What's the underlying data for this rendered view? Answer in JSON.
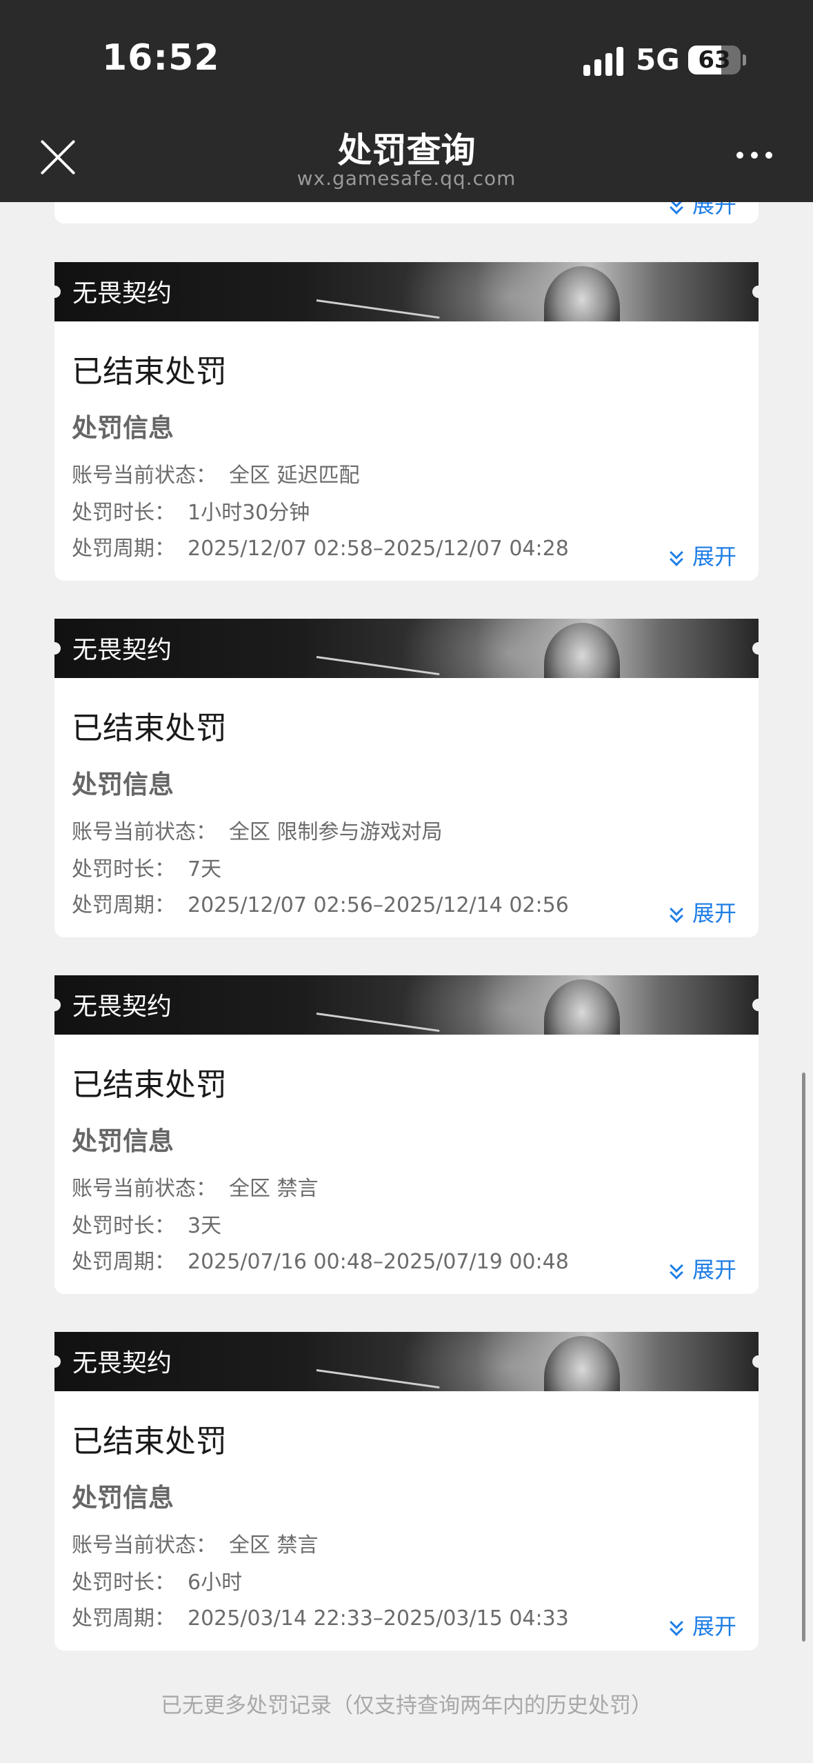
{
  "status_bar": {
    "time": "16:52",
    "network": "5G",
    "battery": "63",
    "battery_level": 0.63
  },
  "nav": {
    "title": "处罚查询",
    "subtitle": "wx.gamesafe.qq.com"
  },
  "labels": {
    "section": "处罚信息",
    "account_status": "账号当前状态：",
    "duration": "处罚时长：",
    "period": "处罚周期：",
    "expand": "展开"
  },
  "prev_card": {
    "expand": "展开"
  },
  "records": [
    {
      "game": "无畏契约",
      "status": "已结束处罚",
      "account_state": "全区 延迟匹配",
      "duration": "1小时30分钟",
      "period": "2025/12/07 02:58–2025/12/07 04:28"
    },
    {
      "game": "无畏契约",
      "status": "已结束处罚",
      "account_state": "全区 限制参与游戏对局",
      "duration": "7天",
      "period": "2025/12/07 02:56–2025/12/14 02:56"
    },
    {
      "game": "无畏契约",
      "status": "已结束处罚",
      "account_state": "全区 禁言",
      "duration": "3天",
      "period": "2025/07/16 00:48–2025/07/19 00:48"
    },
    {
      "game": "无畏契约",
      "status": "已结束处罚",
      "account_state": "全区 禁言",
      "duration": "6小时",
      "period": "2025/03/14 22:33–2025/03/15 04:33"
    }
  ],
  "footer": "已无更多处罚记录（仅支持查询两年内的历史处罚）",
  "colors": {
    "accent": "#1e7ee6",
    "header_bg": "#2a2a2a",
    "page_bg": "#f0f0f0"
  }
}
